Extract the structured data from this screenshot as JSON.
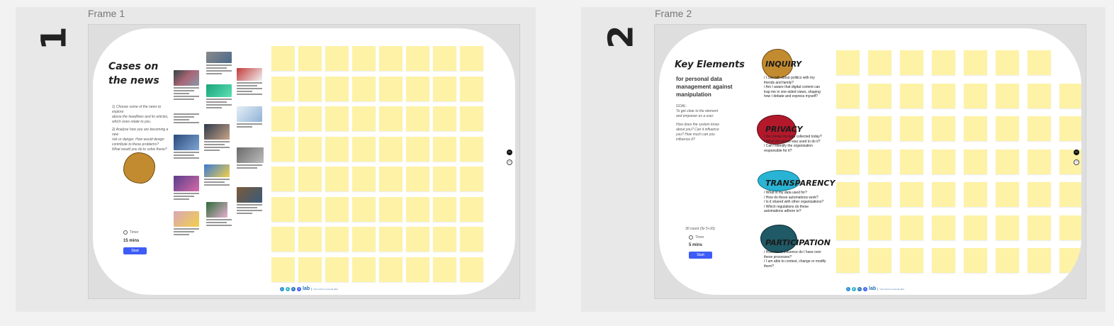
{
  "sections": [
    {
      "number": "1",
      "frame_label": "Frame 1"
    },
    {
      "number": "2",
      "frame_label": "Frame 2"
    }
  ],
  "frame1": {
    "title_line1": "Cases on",
    "title_line2": "the news",
    "instructions": [
      "1) Choose some of the news to explore",
      "above the headlines and its articles,",
      "which ones relate to you.",
      "2) Analyse how you are becoming a new",
      "risk or danger. How would design",
      "contribute to these problems?",
      "What would you do to solve these?"
    ],
    "timer_label": "Timer",
    "duration": "15 mins",
    "start_label": "Start"
  },
  "frame2": {
    "title": "Key Elements",
    "subtitle_lines": [
      "for personal data",
      "management against",
      "manipulation"
    ],
    "goal_lines": [
      "GOAL:",
      "To get clear to the element",
      "and empower as a user.",
      "",
      "How does the system know",
      "about you? Can it influence",
      "you? How much can you",
      "influence it?"
    ],
    "footnote": "30 count (3x 5+10)",
    "timer_label": "Timer",
    "duration": "5 mins",
    "start_label": "Start",
    "elements": [
      {
        "title": "INQUIRY",
        "color": "#c38b30",
        "questions": [
          "/ I can talk about politics with my",
          "friends and family?",
          "/ Am I aware that digital content can",
          "trap me in one-sided views, shaping",
          "how I debate and express myself?"
        ]
      },
      {
        "title": "PRIVACY",
        "color": "#b3192b",
        "questions": [
          "/ Do I know my data collected today?",
          "/ What document was used to do it?",
          "/ Can I identify the organisation",
          "responsible for it?"
        ]
      },
      {
        "title": "TRANSPARENCY",
        "color": "#29b3d4",
        "questions": [
          "/ What is my data used for?",
          "/ How do these automations work?",
          "/ Is it shared with other organizations?",
          "/ Which regulations do these",
          "automations adhere to?"
        ]
      },
      {
        "title": "PARTICIPATION",
        "color": "#1f5a66",
        "questions": [
          "/ How much influence do I have over",
          "these processes?",
          "/ I am able to contest, change or modify",
          "them?"
        ]
      }
    ]
  },
  "logo": {
    "letters": [
      "L",
      "E",
      "N",
      "S"
    ],
    "name": "lab",
    "tagline": "Civic lab for personal data"
  },
  "colors": {
    "sticky": "#fdf2a6",
    "start_button": "#3d5cf5",
    "board": "#ffffff"
  },
  "icons": [
    "fit-view-icon",
    "settings-icon"
  ]
}
